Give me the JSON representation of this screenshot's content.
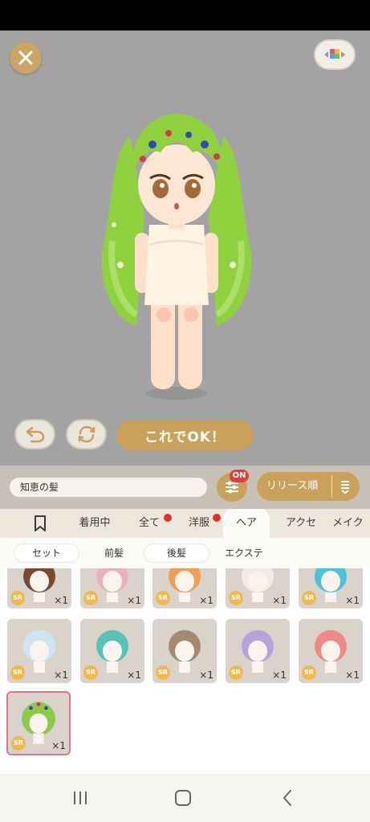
{
  "stage": {
    "ok_label": "これでOK！",
    "background": "#a3a3a3",
    "accent": "#c9a15a"
  },
  "toolbar": {
    "item_name": "知恵の髪",
    "filter_badge": "ON",
    "sort_label": "リリース順"
  },
  "tabs": [
    {
      "label": "着用中"
    },
    {
      "label": "全て"
    },
    {
      "label": "洋服"
    },
    {
      "label": "ヘア"
    },
    {
      "label": "アクセ"
    },
    {
      "label": "メイク"
    }
  ],
  "subtabs": [
    {
      "label": "セット"
    },
    {
      "label": "前髪"
    },
    {
      "label": "後髪"
    },
    {
      "label": "エクステ"
    }
  ],
  "items": [
    {
      "badge": "SR",
      "qty": "×1",
      "hair": "#7a4a30"
    },
    {
      "badge": "SR",
      "qty": "×1",
      "hair": "#e7b3b9"
    },
    {
      "badge": "SR",
      "qty": "×1",
      "hair": "#f0a052"
    },
    {
      "badge": "SR",
      "qty": "×1",
      "hair": "#f3ece2"
    },
    {
      "badge": "SR",
      "qty": "×1",
      "hair": "#4cc3d6"
    },
    {
      "badge": "SR",
      "qty": "×1",
      "hair": "#cfe6f2"
    },
    {
      "badge": "SR",
      "qty": "×1",
      "hair": "#58c2b8"
    },
    {
      "badge": "SR",
      "qty": "×1",
      "hair": "#a58a72"
    },
    {
      "badge": "SR",
      "qty": "×1",
      "hair": "#b9a2dc"
    },
    {
      "badge": "SR",
      "qty": "×1",
      "hair": "#f08a88"
    },
    {
      "badge": "SR",
      "qty": "×1",
      "hair": "#8fc84a"
    }
  ]
}
